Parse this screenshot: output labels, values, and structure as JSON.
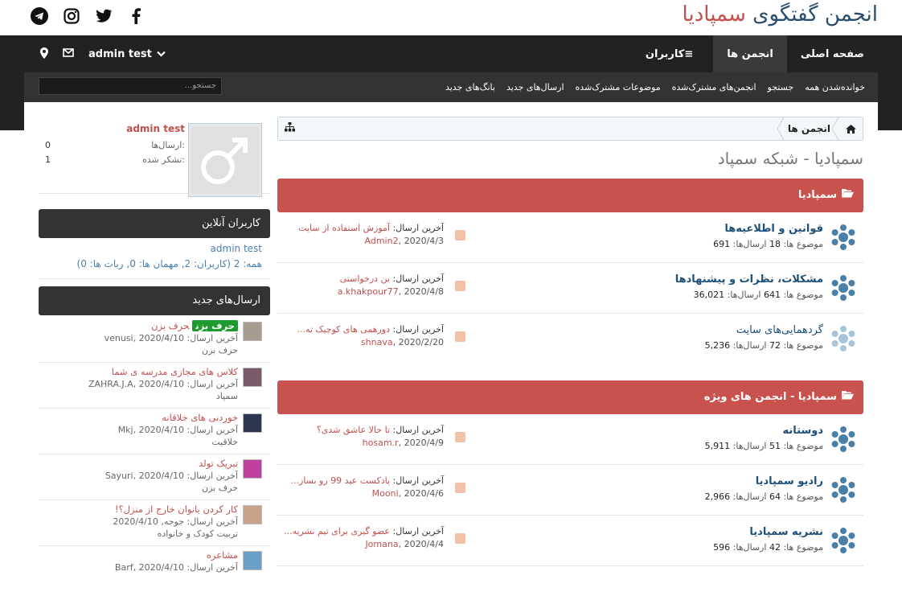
{
  "header": {
    "title_part1": "انجمن گفتگوی",
    "title_part2": "سمپادیا",
    "social": [
      "telegram-icon",
      "instagram-icon",
      "twitter-icon",
      "facebook-icon"
    ]
  },
  "nav": {
    "tabs": [
      {
        "label": "صفحه اصلی",
        "active": false
      },
      {
        "label": "انجمن ها",
        "active": true
      },
      {
        "label": "کاربران",
        "active": false
      }
    ],
    "user": "admin test"
  },
  "subnav": {
    "links": [
      "خواندەشدن همه",
      "جستجو",
      "انجمن‌های مشترک‌شده",
      "موضوعات مشترک‌شده",
      "ارسال‌های جدید",
      "بانگ‌های جدید"
    ],
    "search_placeholder": "جستجو..."
  },
  "breadcrumb": {
    "item": "انجمن ها"
  },
  "forum_title": "سمپادیا - شبکه سمپاد",
  "categories": [
    {
      "title": "سمپادیا",
      "forums": [
        {
          "name": "قوانین و اطلاعیه‌ها",
          "topics_label": "موضوع ها:",
          "topics": "18",
          "posts_label": "ارسال‌ها:",
          "posts": "691",
          "last_label": "آخرین ارسال:",
          "last_title": "آموزش استفاده از سایت",
          "last_user": "Admin2",
          "last_date": "2020/4/3",
          "light": false
        },
        {
          "name": "مشکلات، نظرات و پیشنهادها",
          "topics_label": "موضوع ها:",
          "topics": "641",
          "posts_label": "ارسال‌ها:",
          "posts": "36,021",
          "last_label": "آخرین ارسال:",
          "last_title": "بن درخواستی",
          "last_user": "a.khakpour77",
          "last_date": "2020/4/8",
          "light": false
        },
        {
          "name": "گردهمایی‌های سایت",
          "topics_label": "موضوع ها:",
          "topics": "72",
          "posts_label": "ارسال‌ها:",
          "posts": "5,236",
          "last_label": "آخرین ارسال:",
          "last_title": "دورهمی های کوچیک ته...",
          "last_user": "shnava",
          "last_date": "2020/2/20",
          "light": true
        }
      ]
    },
    {
      "title": "سمپادیا - انجمن های ویژه",
      "forums": [
        {
          "name": "دوستانه",
          "topics_label": "موضوع ها:",
          "topics": "51",
          "posts_label": "ارسال‌ها:",
          "posts": "5,911",
          "last_label": "آخرین ارسال:",
          "last_title": "تا حالا عاشق شدی؟",
          "last_user": "hosam.r",
          "last_date": "2020/4/9",
          "light": false
        },
        {
          "name": "رادیو سمپادیا",
          "topics_label": "موضوع ها:",
          "topics": "64",
          "posts_label": "ارسال‌ها:",
          "posts": "2,966",
          "last_label": "آخرین ارسال:",
          "last_title": "پادکست عید 99 رو بساز...",
          "last_user": "Mooni",
          "last_date": "2020/4/6",
          "light": false
        },
        {
          "name": "نشریه سمپادیا",
          "topics_label": "موضوع ها:",
          "topics": "42",
          "posts_label": "ارسال‌ها:",
          "posts": "596",
          "last_label": "آخرین ارسال:",
          "last_title": "عضو گیری برای تیم نشریه...",
          "last_user": "Jomana",
          "last_date": "2020/4/4",
          "light": false
        }
      ]
    }
  ],
  "profile": {
    "name": "admin test",
    "posts_label": "ارسال‌ها:",
    "posts": "0",
    "thanks_label": "تشکر شده:",
    "thanks": "1"
  },
  "online": {
    "title": "کاربران آنلاین",
    "user": "admin test",
    "summary": "همه: 2 (کاربران: 2, مهمان ها: 0, ربات ها: 0)"
  },
  "new_posts": {
    "title": "ارسال‌های جدید",
    "items": [
      {
        "tag": "حرف بزن",
        "title": "حرف بزن",
        "meta": "آخرین ارسال: venusi, 2020/4/10",
        "forum": "حرف بزن",
        "thumb": "#a89b8f"
      },
      {
        "tag": "",
        "title": "کلاس های مجازی مدرسه ی شما",
        "meta": "آخرین ارسال: ZAHRA.J.A, 2020/4/10",
        "forum": "سمپاد",
        "thumb": "#7a5a6a"
      },
      {
        "tag": "",
        "title": "خوردنی های خلاقانه",
        "meta": "آخرین ارسال: Mkj, 2020/4/10",
        "forum": "خلاقیت",
        "thumb": "#2b3550"
      },
      {
        "tag": "",
        "title": "تبریک تولد",
        "meta": "آخرین ارسال: Sayuri, 2020/4/10",
        "forum": "حرف بزن",
        "thumb": "#c040a0"
      },
      {
        "tag": "",
        "title": "کار کردن بانوان خارج از منزل؟!",
        "meta": "آخرین ارسال: جوجه, 2020/4/10",
        "forum": "تربیت کودک و خانواده",
        "thumb": "#c9a08a"
      },
      {
        "tag": "",
        "title": "مشاعره",
        "meta": "آخرین ارسال: Barf, 2020/4/10",
        "forum": "",
        "thumb": "#6aa0c8"
      }
    ]
  }
}
